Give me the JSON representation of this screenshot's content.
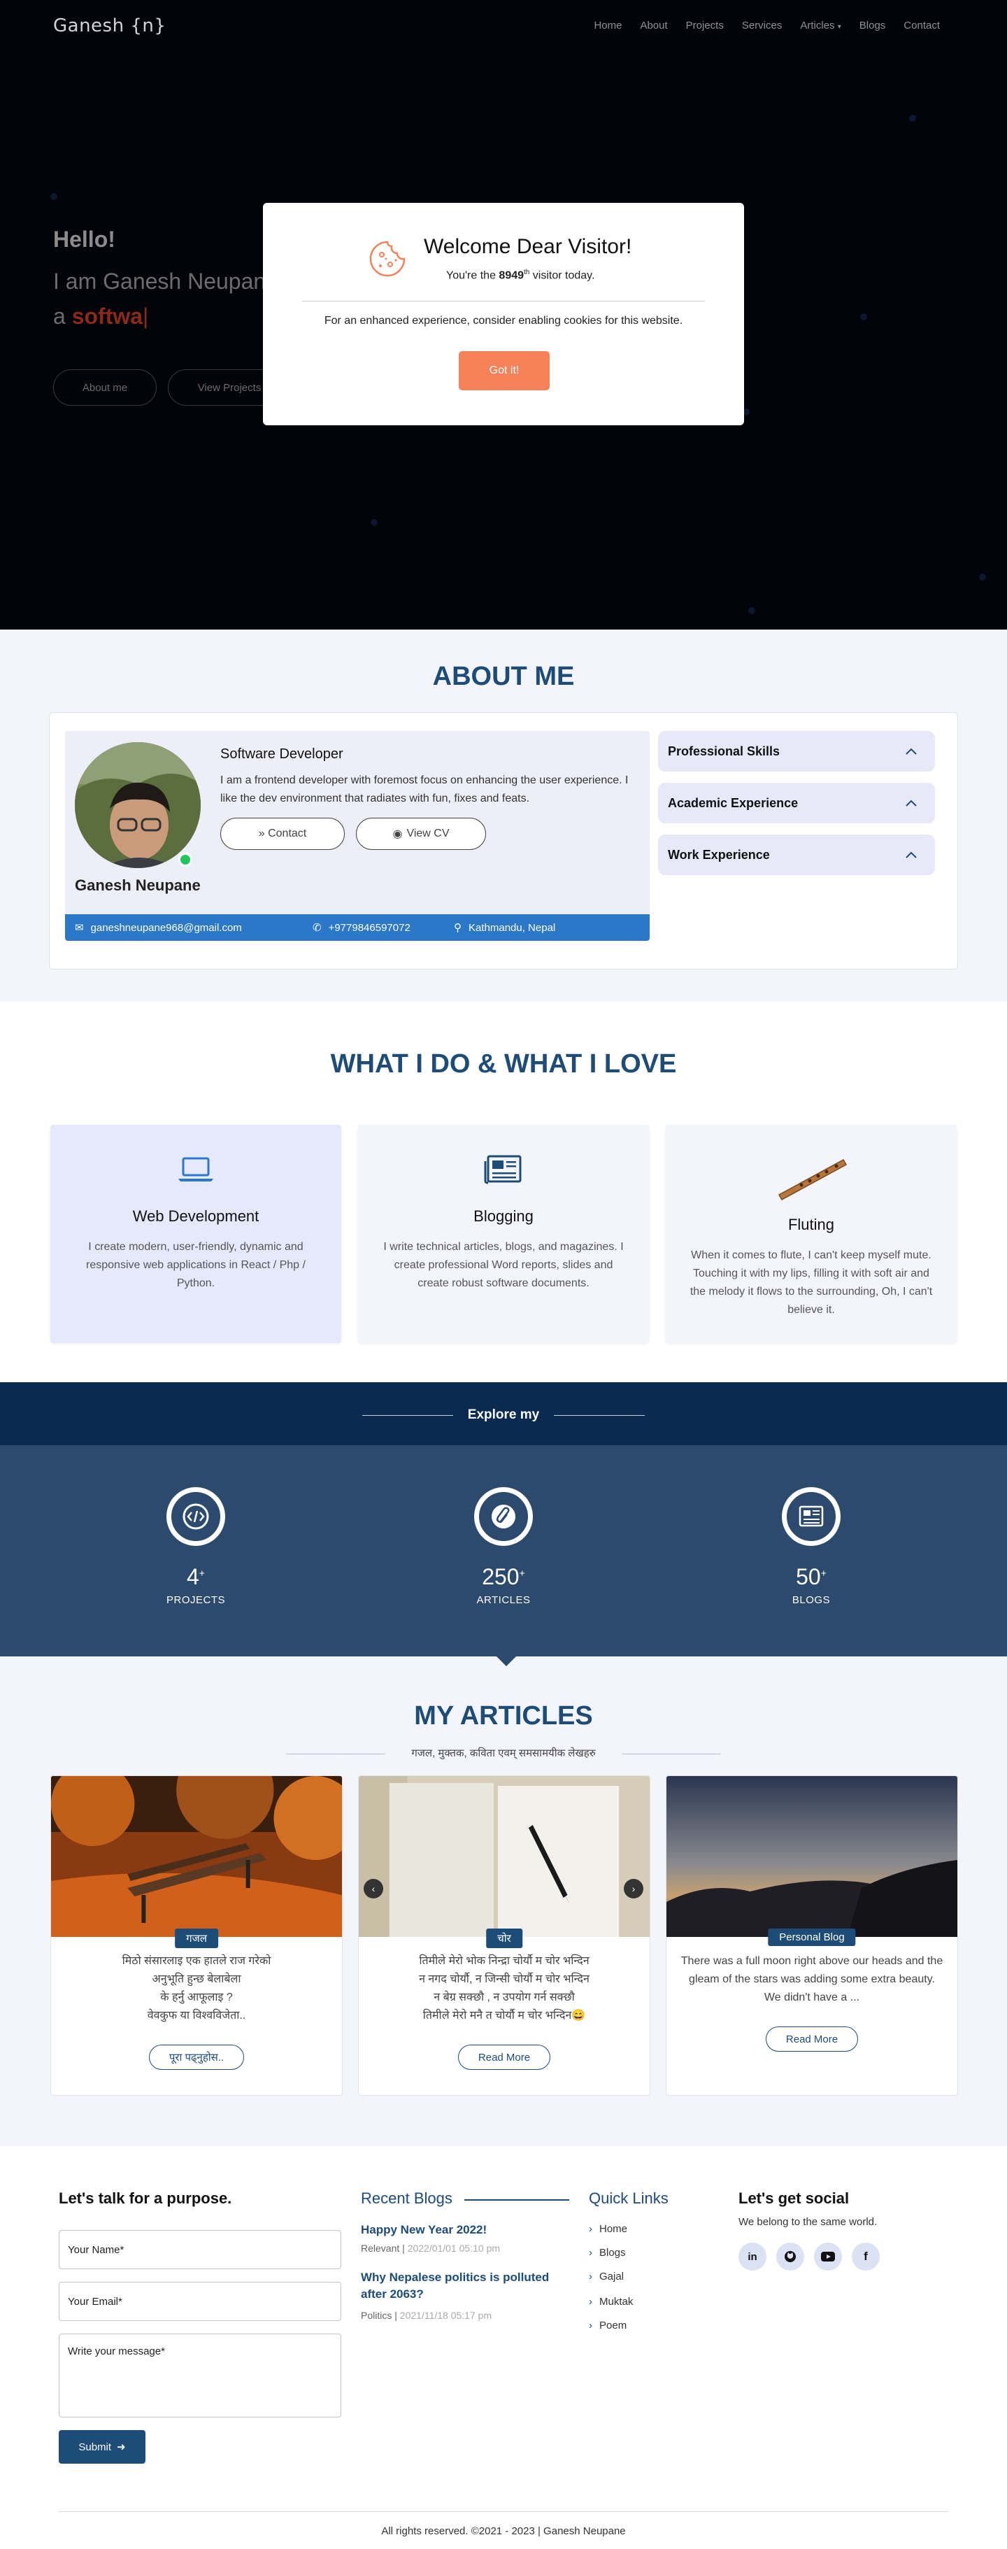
{
  "nav": {
    "brand": "Ganesh {n}",
    "items": [
      {
        "label": "Home",
        "active": false
      },
      {
        "label": "About",
        "active": false
      },
      {
        "label": "Projects",
        "active": false
      },
      {
        "label": "Services",
        "active": false
      },
      {
        "label": "Articles",
        "active": true
      },
      {
        "label": "Blogs",
        "active": false
      },
      {
        "label": "Contact",
        "active": false
      }
    ]
  },
  "hero": {
    "hello": "Hello!",
    "name": "I am Ganesh Neupane",
    "typed_prefix": "a ",
    "typed_text": "softwa",
    "about_button": "About me",
    "projects_button": "View Projects"
  },
  "modal": {
    "title": "Welcome Dear Visitor!",
    "sub_prefix": "You're the ",
    "visitor_count": "8949",
    "visitor_suffix": "th",
    "sub_suffix": " visitor today.",
    "body": "For an enhanced experience, consider enabling cookies for this website.",
    "button": "Got it!"
  },
  "about": {
    "title": "ABOUT ME",
    "role": "Software Developer",
    "bio": "I am a frontend developer with foremost focus on enhancing the user experience. I like the dev environment that radiates with fun, fixes and feats.",
    "contact_button": "» Contact",
    "cv_button": "View CV",
    "name": "Ganesh Neupane",
    "email": "ganeshneupane968@gmail.com",
    "phone": "+9779846597072",
    "location": "Kathmandu, Nepal",
    "accordions": [
      "Professional Skills",
      "Academic Experience",
      "Work Experience"
    ]
  },
  "whatdo": {
    "title": "WHAT I DO & WHAT I LOVE",
    "cards": [
      {
        "title": "Web Development",
        "text": "I create modern, user-friendly, dynamic and responsive web applications in React / Php / Python."
      },
      {
        "title": "Blogging",
        "text": "I write technical articles, blogs, and magazines. I create professional Word reports, slides and create robust software documents."
      },
      {
        "title": "Fluting",
        "text": "When it comes to flute, I can't keep myself mute. Touching it with my lips, filling it with soft air and the melody it flows to the surrounding, Oh, I can't believe it."
      }
    ]
  },
  "explore": {
    "label": "Explore my",
    "stats": [
      {
        "num": "4",
        "plus": "+",
        "label": "PROJECTS"
      },
      {
        "num": "250",
        "plus": "+",
        "label": "ARTICLES"
      },
      {
        "num": "50",
        "plus": "+",
        "label": "BLOGS"
      }
    ]
  },
  "articles": {
    "title": "MY ARTICLES",
    "subtitle": "गजल, मुक्तक, कविता एवम् समसामयीक लेखहरु",
    "cards": [
      {
        "tag": "गजल",
        "lines": [
          "मिठो संसारलाइ एक हातले राज गरेको",
          "अनुभूति हुन्छ बेलाबेला",
          "के हर्नु आफूलाइ ?",
          "वेवकुफ या विश्वविजेता.."
        ],
        "button": "पूरा पढ्नुहोस.."
      },
      {
        "tag": "चोर",
        "lines": [
          "तिमीले मेरो भोक निन्द्रा चोर्यौ म चोर भन्दिन",
          "न नगद चोर्यौ, न जिन्सी चोर्यौ म चोर भन्दिन",
          "न बेग्र सक्छौ , न उपयोग गर्न सक्छौ",
          "तिमीले मेरो मनै त चोर्यौ म चोर भन्दिन😄"
        ],
        "button": "Read More"
      },
      {
        "tag": "Personal Blog",
        "lines": [
          "There was a full moon right above our heads and the gleam of the stars was adding some extra beauty. We didn't have a ..."
        ],
        "button": "Read More"
      }
    ]
  },
  "footer": {
    "talk_title": "Let's talk for a purpose.",
    "name_field": "Your Name*",
    "email_field": "Your Email*",
    "message_field": "Write your message*",
    "submit": "Submit",
    "recent_title": "Recent Blogs",
    "blogs": [
      {
        "title": "Happy New Year 2022!",
        "category": "Relevant",
        "date": "2022/01/01 05:10 pm"
      },
      {
        "title": "Why Nepalese politics is polluted after 2063?",
        "category": "Politics",
        "date": "2021/11/18 05:17 pm"
      }
    ],
    "links_title": "Quick Links",
    "links": [
      "Home",
      "Blogs",
      "Gajal",
      "Muktak",
      "Poem"
    ],
    "social_title": "Let's get social",
    "social_sub": "We belong to the same world.",
    "copyright": "All rights reserved. ©2021 - 2023  |  Ganesh Neupane"
  },
  "colors": {
    "accent": "#1d4c78",
    "cta": "#f6825a",
    "contact_bar": "#2c78c8",
    "explore_dark": "#0b2a52",
    "explore_body": "#2b4a6e"
  }
}
